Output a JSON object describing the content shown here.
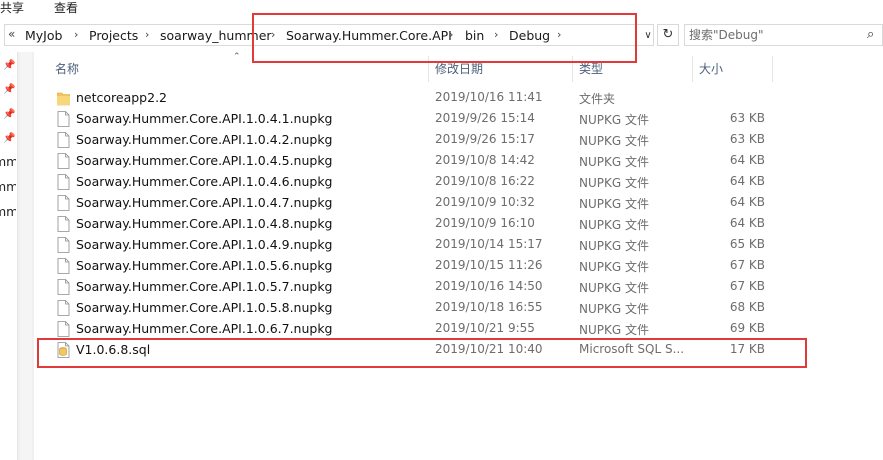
{
  "ribbon": {
    "share": "共享",
    "view": "查看"
  },
  "address": {
    "overflow": "«",
    "crumbs": [
      "MyJob",
      "Projects",
      "soarway_hummer",
      "Soarway.Hummer.Core.API",
      "bin",
      "Debug"
    ]
  },
  "search": {
    "placeholder": "搜索\"Debug\""
  },
  "nav": {
    "items": [
      "mm",
      "mm",
      "mm"
    ]
  },
  "columns": {
    "name": "名称",
    "date": "修改日期",
    "type": "类型",
    "size": "大小"
  },
  "files": [
    {
      "name": "netcoreapp2.2",
      "date": "2019/10/16 11:41",
      "type": "文件夹",
      "size": "",
      "icon": "folder-icon"
    },
    {
      "name": "Soarway.Hummer.Core.API.1.0.4.1.nupkg",
      "date": "2019/9/26 15:14",
      "type": "NUPKG 文件",
      "size": "63 KB",
      "icon": "file-icon"
    },
    {
      "name": "Soarway.Hummer.Core.API.1.0.4.2.nupkg",
      "date": "2019/9/26 15:17",
      "type": "NUPKG 文件",
      "size": "63 KB",
      "icon": "file-icon"
    },
    {
      "name": "Soarway.Hummer.Core.API.1.0.4.5.nupkg",
      "date": "2019/10/8 14:42",
      "type": "NUPKG 文件",
      "size": "64 KB",
      "icon": "file-icon"
    },
    {
      "name": "Soarway.Hummer.Core.API.1.0.4.6.nupkg",
      "date": "2019/10/8 16:22",
      "type": "NUPKG 文件",
      "size": "64 KB",
      "icon": "file-icon"
    },
    {
      "name": "Soarway.Hummer.Core.API.1.0.4.7.nupkg",
      "date": "2019/10/9 10:32",
      "type": "NUPKG 文件",
      "size": "64 KB",
      "icon": "file-icon"
    },
    {
      "name": "Soarway.Hummer.Core.API.1.0.4.8.nupkg",
      "date": "2019/10/9 16:10",
      "type": "NUPKG 文件",
      "size": "64 KB",
      "icon": "file-icon"
    },
    {
      "name": "Soarway.Hummer.Core.API.1.0.4.9.nupkg",
      "date": "2019/10/14 15:17",
      "type": "NUPKG 文件",
      "size": "65 KB",
      "icon": "file-icon"
    },
    {
      "name": "Soarway.Hummer.Core.API.1.0.5.6.nupkg",
      "date": "2019/10/15 11:26",
      "type": "NUPKG 文件",
      "size": "67 KB",
      "icon": "file-icon"
    },
    {
      "name": "Soarway.Hummer.Core.API.1.0.5.7.nupkg",
      "date": "2019/10/16 14:50",
      "type": "NUPKG 文件",
      "size": "67 KB",
      "icon": "file-icon"
    },
    {
      "name": "Soarway.Hummer.Core.API.1.0.5.8.nupkg",
      "date": "2019/10/18 16:55",
      "type": "NUPKG 文件",
      "size": "68 KB",
      "icon": "file-icon"
    },
    {
      "name": "Soarway.Hummer.Core.API.1.0.6.7.nupkg",
      "date": "2019/10/21 9:55",
      "type": "NUPKG 文件",
      "size": "69 KB",
      "icon": "file-icon"
    },
    {
      "name": "V1.0.6.8.sql",
      "date": "2019/10/21 10:40",
      "type": "Microsoft SQL S...",
      "size": "17 KB",
      "icon": "sql-file-icon"
    }
  ],
  "colors": {
    "highlight_box": "#e03a3a",
    "header_text": "#4c607a",
    "folder": "#f3c45b"
  }
}
